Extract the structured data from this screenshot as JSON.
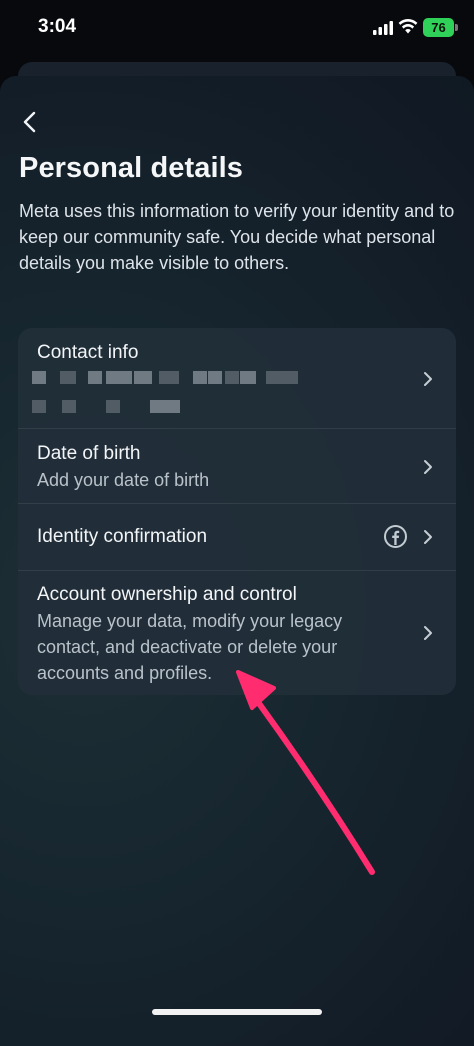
{
  "status_bar": {
    "time": "3:04",
    "battery": "76"
  },
  "header": {
    "title": "Personal details",
    "description": "Meta uses this information to verify your identity and to keep our community safe. You decide what personal details you make visible to others."
  },
  "items": [
    {
      "title": "Contact info",
      "subtitle": ""
    },
    {
      "title": "Date of birth",
      "subtitle": "Add your date of birth"
    },
    {
      "title": "Identity confirmation",
      "subtitle": ""
    },
    {
      "title": "Account ownership and control",
      "subtitle": "Manage your data, modify your legacy contact, and deactivate or delete your accounts and profiles."
    }
  ],
  "icons": {
    "back": "chevron-left-icon",
    "chevron": "chevron-right-icon",
    "identity": "facebook-icon"
  },
  "colors": {
    "annotation_arrow": "#ff2d6f",
    "battery": "#30d158"
  }
}
